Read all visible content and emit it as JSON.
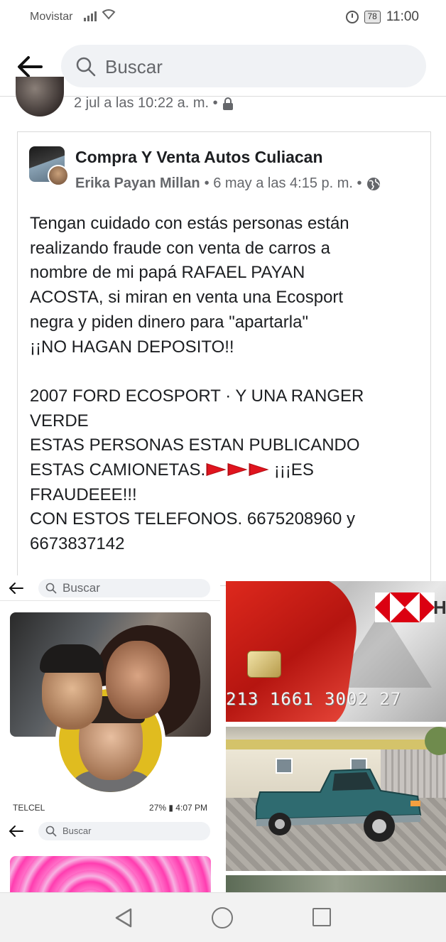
{
  "status_bar": {
    "carrier": "Movistar",
    "battery": "78",
    "time": "11:00"
  },
  "header": {
    "search_placeholder": "Buscar"
  },
  "previous_post": {
    "meta": "2 jul a las 10:22 a. m. •"
  },
  "post": {
    "group_name": "Compra Y Venta Autos Culiacan",
    "author": "Erika Payan Millan",
    "meta_time": "• 6 may a las 4:15 p. m. •",
    "body_lines": [
      "Tengan cuidado con estás personas están",
      "realizando fraude con venta de carros a",
      "nombre de mi papá RAFAEL PAYAN",
      "ACOSTA, si miran en venta una Ecosport",
      "negra y piden dinero para \"apartarla\"",
      "¡¡NO HAGAN DEPOSITO!!",
      "",
      "2007 FORD ECOSPORT · Y UNA RANGER",
      "VERDE",
      "ESTAS PERSONAS ESTAN PUBLICANDO",
      "ESTAS CAMIONETAS.",
      "¡¡¡ES",
      "FRAUDEEE!!!",
      "CON ESTOS TELEFONOS. 6675208960 y",
      "6673837142"
    ],
    "flag_color": "#e0141e"
  },
  "collage": {
    "mini_search_placeholder": "Buscar",
    "mini_carrier": "TELCEL",
    "mini_status": "27% ▮ 4:07 PM",
    "card_number": "213 1661 3002 27",
    "bank_letter": "H",
    "bank_red": "#db0011"
  },
  "nav": {
    "back": "back-icon",
    "home": "home-icon",
    "recents": "recents-icon"
  }
}
